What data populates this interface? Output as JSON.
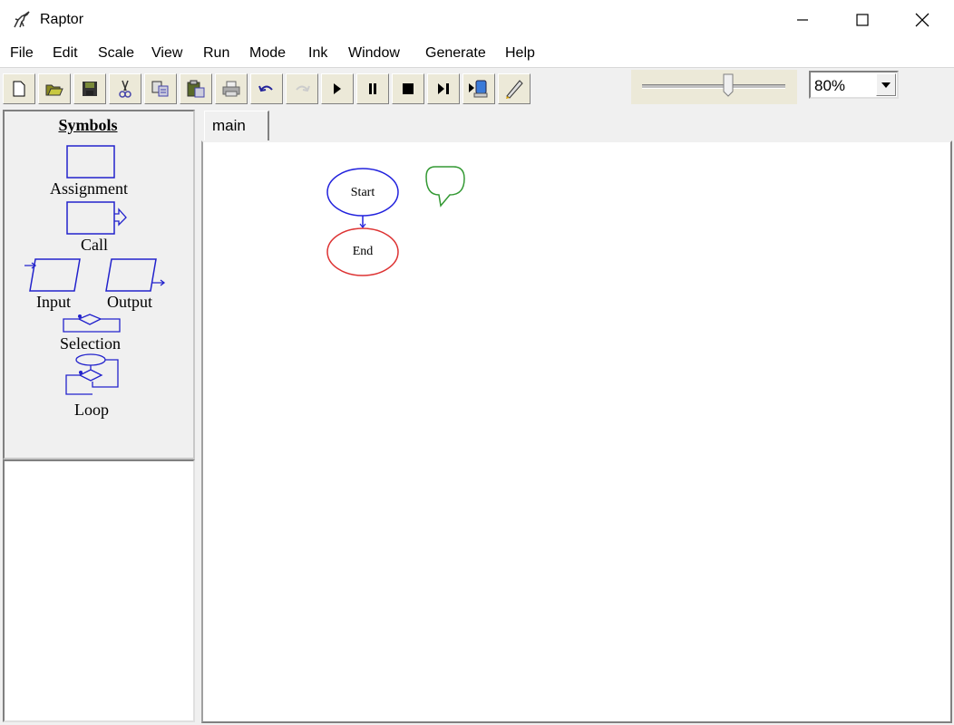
{
  "window": {
    "title": "Raptor",
    "controls": {
      "minimize": "minimize-icon",
      "maximize": "maximize-icon",
      "close": "close-icon"
    }
  },
  "menu": {
    "items": [
      "File",
      "Edit",
      "Scale",
      "View",
      "Run",
      "Mode",
      "Ink",
      "Window",
      "Generate",
      "Help"
    ]
  },
  "toolbar": {
    "buttons": [
      {
        "name": "new",
        "icon": "new-file-icon",
        "enabled": true
      },
      {
        "name": "open",
        "icon": "open-folder-icon",
        "enabled": true
      },
      {
        "name": "save",
        "icon": "save-disk-icon",
        "enabled": true
      },
      {
        "name": "cut",
        "icon": "scissors-icon",
        "enabled": true
      },
      {
        "name": "copy",
        "icon": "copy-icon",
        "enabled": true
      },
      {
        "name": "paste",
        "icon": "paste-icon",
        "enabled": true
      },
      {
        "name": "print",
        "icon": "printer-icon",
        "enabled": true
      },
      {
        "name": "undo",
        "icon": "undo-icon",
        "enabled": true
      },
      {
        "name": "redo",
        "icon": "redo-icon",
        "enabled": false
      },
      {
        "name": "execute",
        "icon": "play-icon",
        "enabled": true
      },
      {
        "name": "pause",
        "icon": "pause-icon",
        "enabled": true
      },
      {
        "name": "stop",
        "icon": "stop-icon",
        "enabled": true
      },
      {
        "name": "step",
        "icon": "step-icon",
        "enabled": true
      },
      {
        "name": "server",
        "icon": "server-run-icon",
        "enabled": true
      },
      {
        "name": "ink",
        "icon": "pen-icon",
        "enabled": true
      }
    ],
    "speed_slider": {
      "value_fraction": 0.6
    },
    "zoom": {
      "value": "80%"
    }
  },
  "symbols": {
    "title": "Symbols",
    "items": {
      "assignment": "Assignment",
      "call": "Call",
      "input": "Input",
      "output": "Output",
      "selection": "Selection",
      "loop": "Loop"
    }
  },
  "tabs": [
    {
      "label": "main"
    }
  ],
  "flowchart": {
    "start": {
      "label": "Start",
      "color": "#2222dd"
    },
    "end": {
      "label": "End",
      "color": "#dd3333"
    },
    "comment_color": "#339933",
    "connector_color": "#2222dd"
  },
  "colors": {
    "symbol_stroke": "#2222cc"
  }
}
